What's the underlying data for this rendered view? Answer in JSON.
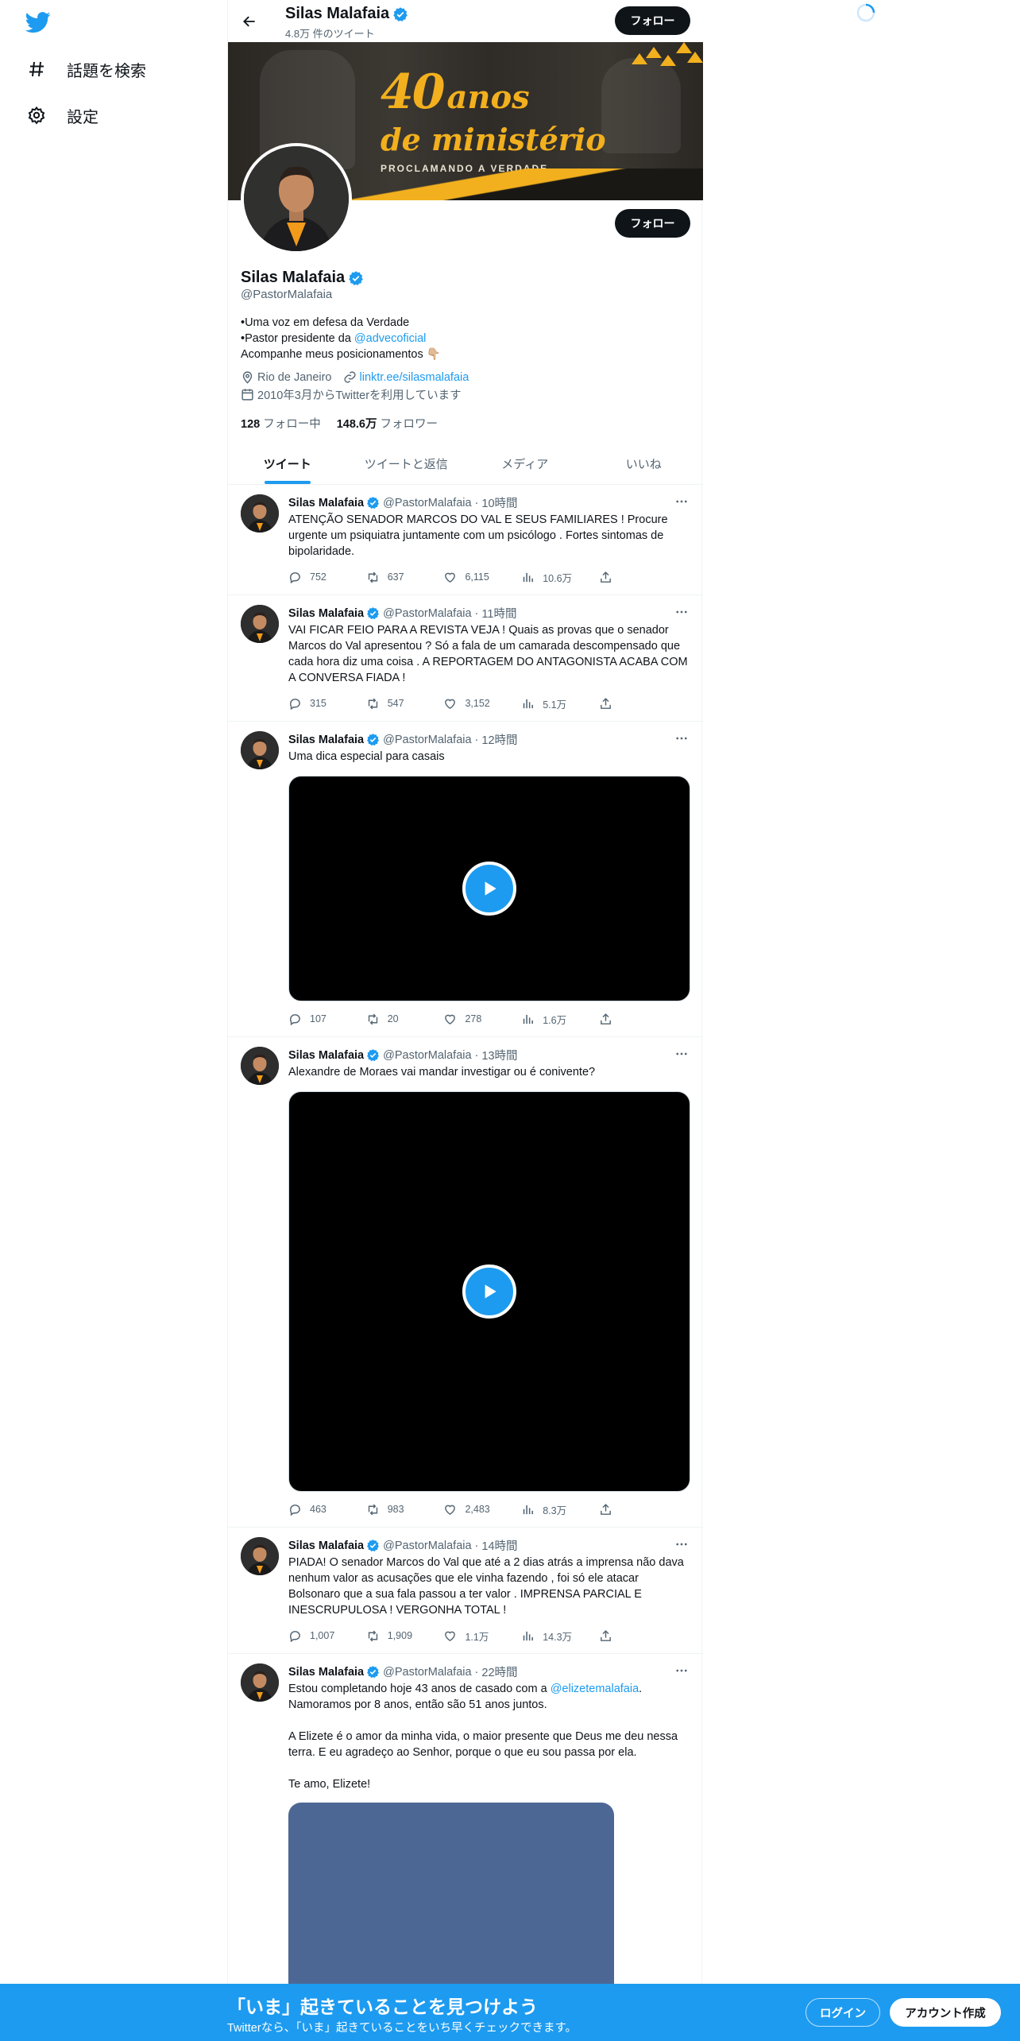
{
  "colors": {
    "accent": "#1d9bf0",
    "text": "#0f1419",
    "muted": "#536471",
    "banner_gold": "#f2b01e"
  },
  "nav": {
    "items": [
      {
        "icon": "hashtag-icon",
        "label": "話題を検索"
      },
      {
        "icon": "gear-icon",
        "label": "設定"
      }
    ]
  },
  "header": {
    "name": "Silas Malafaia",
    "tweet_count": "4.8万 件のツイート",
    "follow_label": "フォロー"
  },
  "banner": {
    "number": "40",
    "word": "anos",
    "line2": "de ministério",
    "line3": "PROCLAMANDO A VERDADE"
  },
  "profile": {
    "name": "Silas Malafaia",
    "handle": "@PastorMalafaia",
    "follow_label": "フォロー",
    "bio_line1": "•Uma voz em defesa da Verdade",
    "bio_line2_prefix": "•Pastor presidente da ",
    "bio_line2_link": "@advecoficial",
    "bio_line3": "Acompanhe meus posicionamentos 👇🏼",
    "location": "Rio de Janeiro",
    "website": "linktr.ee/silasmalafaia",
    "joined": "2010年3月からTwitterを利用しています",
    "following_count": "128",
    "following_label": "フォロー中",
    "followers_count": "148.6万",
    "followers_label": "フォロワー"
  },
  "tabs": [
    {
      "label": "ツイート",
      "active": true
    },
    {
      "label": "ツイートと返信",
      "active": false
    },
    {
      "label": "メディア",
      "active": false
    },
    {
      "label": "いいね",
      "active": false
    }
  ],
  "tweets": [
    {
      "name": "Silas Malafaia",
      "handle": "@PastorMalafaia",
      "time": "10時間",
      "text": "ATENÇÃO SENADOR MARCOS DO VAL E SEUS FAMILIARES ! Procure urgente um psiquiatra juntamente com um psicólogo . Fortes sintomas de bipolaridade.",
      "replies": "752",
      "retweets": "637",
      "likes": "6,115",
      "views": "10.6万"
    },
    {
      "name": "Silas Malafaia",
      "handle": "@PastorMalafaia",
      "time": "11時間",
      "text": "VAI FICAR FEIO PARA A REVISTA VEJA ! Quais as provas que o senador Marcos do Val apresentou ? Só a fala de um camarada descompensado que cada hora diz uma coisa . A REPORTAGEM DO ANTAGONISTA ACABA COM A CONVERSA FIADA !",
      "replies": "315",
      "retweets": "547",
      "likes": "3,152",
      "views": "5.1万"
    },
    {
      "name": "Silas Malafaia",
      "handle": "@PastorMalafaia",
      "time": "12時間",
      "text": "Uma dica especial para casais",
      "replies": "107",
      "retweets": "20",
      "likes": "278",
      "views": "1.6万"
    },
    {
      "name": "Silas Malafaia",
      "handle": "@PastorMalafaia",
      "time": "13時間",
      "text": "Alexandre de Moraes vai mandar investigar ou é conivente?",
      "replies": "463",
      "retweets": "983",
      "likes": "2,483",
      "views": "8.3万"
    },
    {
      "name": "Silas Malafaia",
      "handle": "@PastorMalafaia",
      "time": "14時間",
      "text": "PIADA! O senador Marcos do Val que até a 2 dias atrás a imprensa não dava nenhum valor as acusações que ele vinha fazendo , foi só ele atacar Bolsonaro que a sua fala passou a ter valor . IMPRENSA PARCIAL E INESCRUPULOSA ! VERGONHA TOTAL !",
      "replies": "1,007",
      "retweets": "1,909",
      "likes": "1.1万",
      "views": "14.3万"
    },
    {
      "name": "Silas Malafaia",
      "handle": "@PastorMalafaia",
      "time": "22時間",
      "text_prefix": "Estou completando hoje 43 anos de casado com a ",
      "text_link": "@elizetemalafaia",
      "text_suffix": ". Namoramos por 8 anos, então são 51 anos juntos.",
      "text_p2": "A Elizete é o amor da minha vida, o maior presente que Deus me deu nessa terra. E eu agradeço ao Senhor, porque o que eu sou passa por ela.",
      "text_p3": "Te amo, Elizete!"
    }
  ],
  "bottom": {
    "title": "「いま」起きていることを見つけよう",
    "subtitle": "Twitterなら、「いま」起きていることをいち早くチェックできます。",
    "login": "ログイン",
    "signup": "アカウント作成"
  }
}
